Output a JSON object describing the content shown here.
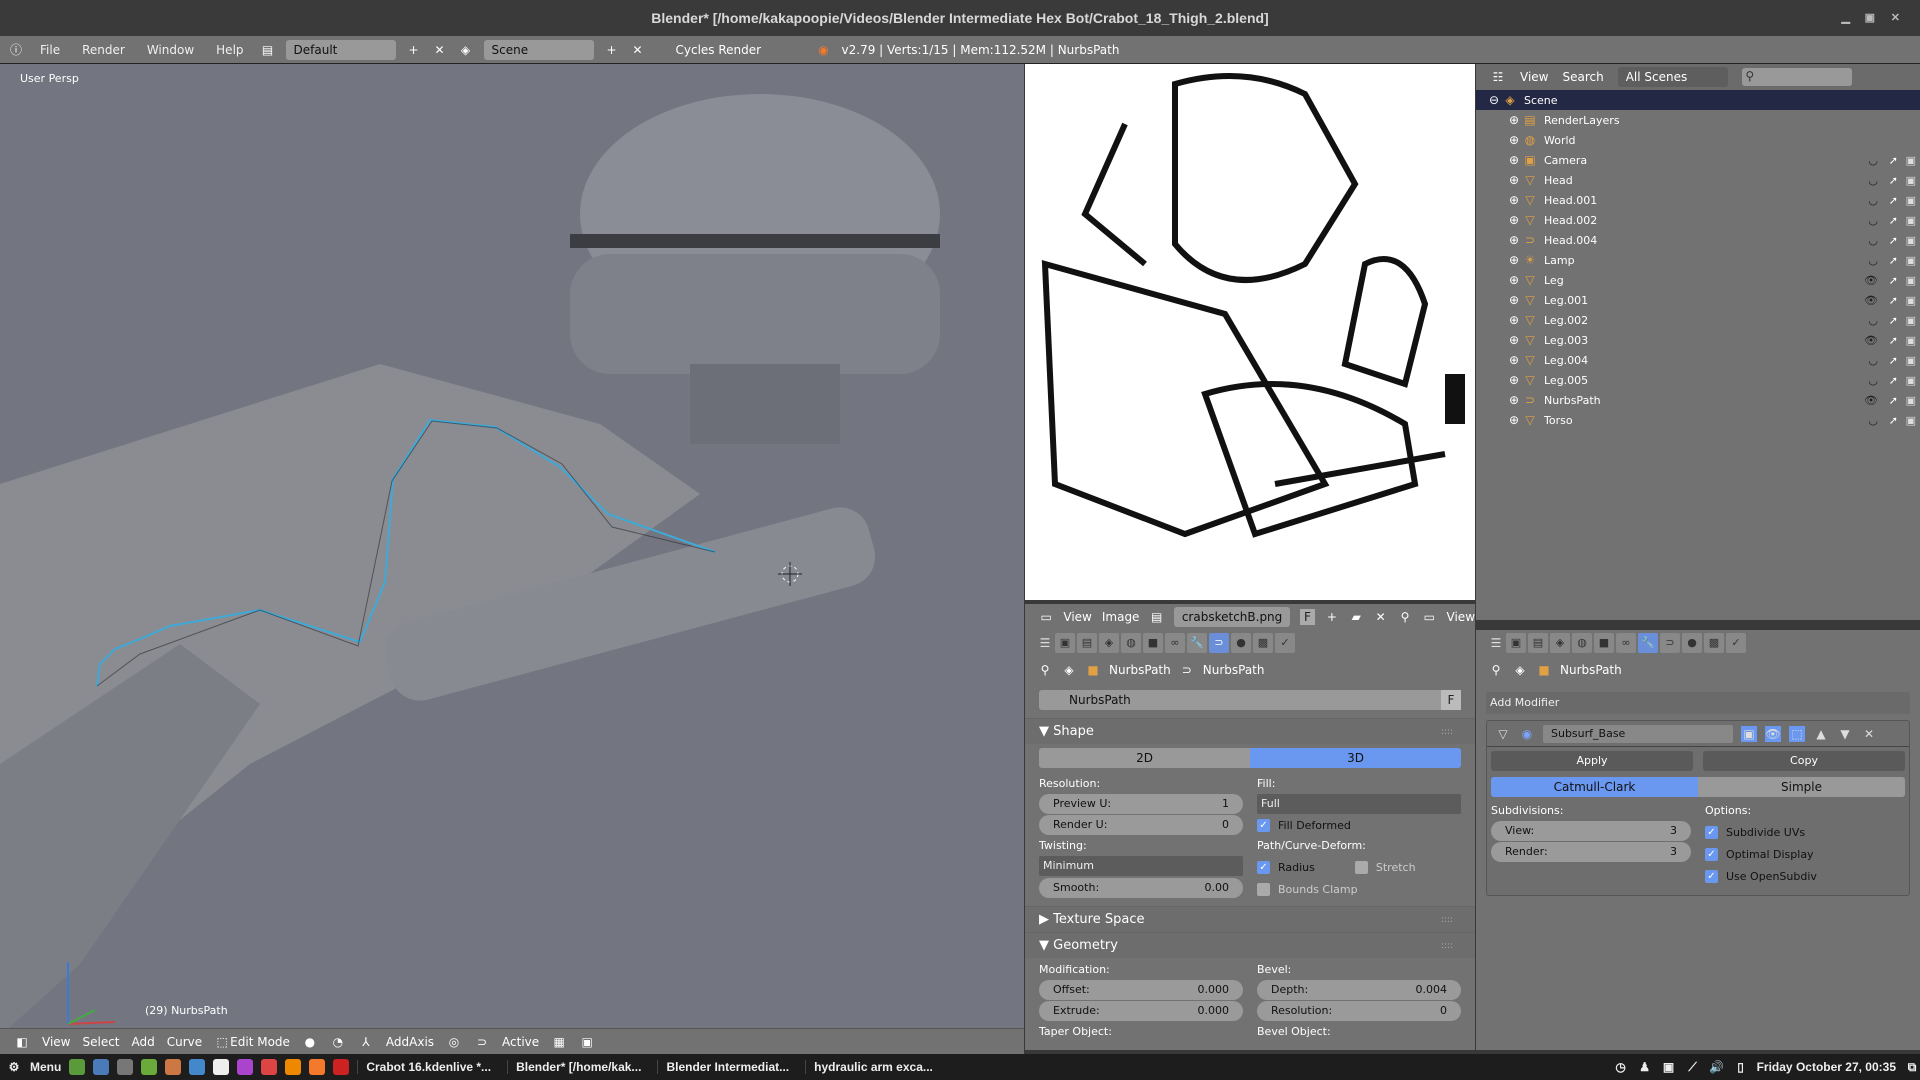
{
  "window": {
    "title": "Blender* [/home/kakapoopie/Videos/Blender Intermediate Hex Bot/Crabot_18_Thigh_2.blend]",
    "controls": [
      "minimize",
      "maximize",
      "close"
    ]
  },
  "infobar": {
    "menus": [
      "File",
      "Render",
      "Window",
      "Help"
    ],
    "layout": "Default",
    "scene": "Scene",
    "engine": "Cycles Render",
    "stats": "v2.79 | Verts:1/15 | Mem:112.52M | NurbsPath"
  },
  "viewport": {
    "view_label": "User Persp",
    "object_label": "(29) NurbsPath",
    "header": {
      "menus": [
        "View",
        "Select",
        "Add",
        "Curve"
      ],
      "mode": "Edit Mode",
      "orientation": "AddAxis",
      "pivot": "Active"
    }
  },
  "image_editor": {
    "menus": [
      "View",
      "Image"
    ],
    "image_name": "crabsketchB.png",
    "fake_user": "F",
    "view_label": "View"
  },
  "properties": {
    "breadcrumb": [
      "NurbsPath",
      "NurbsPath"
    ],
    "datablock_name": "NurbsPath",
    "fake_user": "F",
    "shape": {
      "title": "Shape",
      "dim_options": [
        "2D",
        "3D"
      ],
      "dim_selected": "3D",
      "resolution_label": "Resolution:",
      "preview_u": {
        "label": "Preview U:",
        "value": "1"
      },
      "render_u": {
        "label": "Render U:",
        "value": "0"
      },
      "twisting_label": "Twisting:",
      "twisting": "Minimum",
      "smooth": {
        "label": "Smooth:",
        "value": "0.00"
      },
      "fill_label": "Fill:",
      "fill": "Full",
      "fill_deformed": {
        "label": "Fill Deformed",
        "checked": true
      },
      "path_label": "Path/Curve-Deform:",
      "radius": {
        "label": "Radius",
        "checked": true
      },
      "stretch": {
        "label": "Stretch",
        "checked": false
      },
      "bounds_clamp": {
        "label": "Bounds Clamp",
        "checked": false
      }
    },
    "texture_space": "Texture Space",
    "geometry": {
      "title": "Geometry",
      "modification_label": "Modification:",
      "offset": {
        "label": "Offset:",
        "value": "0.000"
      },
      "extrude": {
        "label": "Extrude:",
        "value": "0.000"
      },
      "bevel_label": "Bevel:",
      "depth": {
        "label": "Depth:",
        "value": "0.004"
      },
      "resolution": {
        "label": "Resolution:",
        "value": "0"
      },
      "taper_label": "Taper Object:",
      "bevel_obj_label": "Bevel Object:"
    }
  },
  "outliner": {
    "menus": [
      "View",
      "Search"
    ],
    "filter": "All Scenes",
    "items": [
      {
        "name": "Scene",
        "icon": "scene-icon",
        "selected": true,
        "visible": null
      },
      {
        "name": "RenderLayers",
        "icon": "renderlayers-icon",
        "visible": null
      },
      {
        "name": "World",
        "icon": "world-icon",
        "visible": null
      },
      {
        "name": "Camera",
        "icon": "camera-icon",
        "visible": false
      },
      {
        "name": "Head",
        "icon": "mesh-icon",
        "visible": false
      },
      {
        "name": "Head.001",
        "icon": "mesh-icon",
        "visible": false
      },
      {
        "name": "Head.002",
        "icon": "mesh-icon",
        "visible": false
      },
      {
        "name": "Head.004",
        "icon": "curve-icon",
        "visible": false
      },
      {
        "name": "Lamp",
        "icon": "lamp-icon",
        "visible": false
      },
      {
        "name": "Leg",
        "icon": "mesh-icon",
        "visible": true
      },
      {
        "name": "Leg.001",
        "icon": "mesh-icon",
        "visible": true
      },
      {
        "name": "Leg.002",
        "icon": "mesh-icon",
        "visible": false
      },
      {
        "name": "Leg.003",
        "icon": "mesh-icon",
        "visible": true
      },
      {
        "name": "Leg.004",
        "icon": "mesh-icon",
        "visible": false
      },
      {
        "name": "Leg.005",
        "icon": "mesh-icon",
        "visible": false
      },
      {
        "name": "NurbsPath",
        "icon": "curve-icon",
        "visible": true
      },
      {
        "name": "Torso",
        "icon": "mesh-icon",
        "visible": false
      }
    ]
  },
  "modifiers": {
    "breadcrumb": "NurbsPath",
    "add_label": "Add Modifier",
    "modifier_name": "Subsurf_Base",
    "apply": "Apply",
    "copy": "Copy",
    "types": [
      "Catmull-Clark",
      "Simple"
    ],
    "type_selected": "Catmull-Clark",
    "subdivisions_label": "Subdivisions:",
    "view": {
      "label": "View:",
      "value": "3"
    },
    "render": {
      "label": "Render:",
      "value": "3"
    },
    "options_label": "Options:",
    "subdivide_uvs": {
      "label": "Subdivide UVs",
      "checked": true
    },
    "optimal_display": {
      "label": "Optimal Display",
      "checked": true
    },
    "use_opensubdiv": {
      "label": "Use OpenSubdiv",
      "checked": true
    }
  },
  "taskbar": {
    "menu": "Menu",
    "tasks": [
      "Crabot 16.kdenlive *...",
      "Blender* [/home/kak...",
      "Blender Intermediat...",
      "hydraulic arm exca..."
    ],
    "clock": "Friday October 27, 00:35"
  },
  "colors": {
    "accent_blue": "#6a98f0",
    "selection": "#232845",
    "curve": "#3fa9d8"
  }
}
